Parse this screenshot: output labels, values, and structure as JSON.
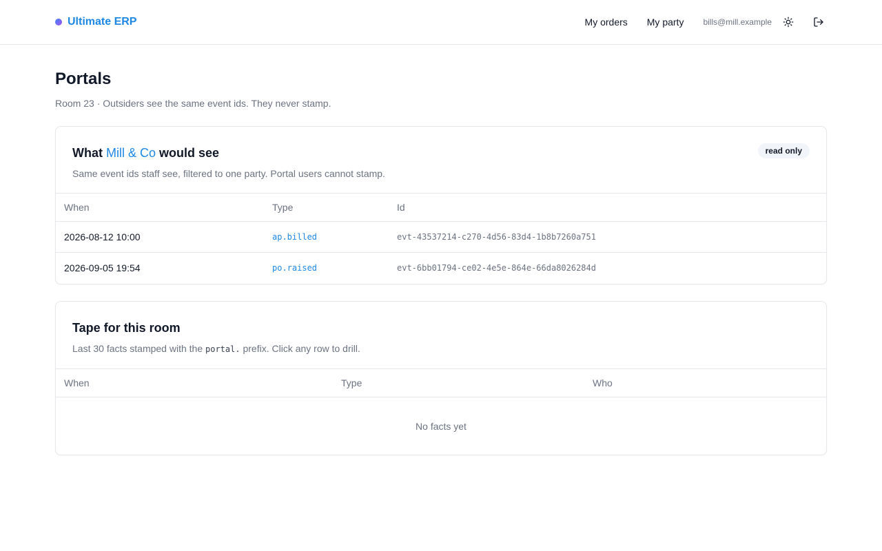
{
  "app": {
    "name": "Ultimate ERP",
    "nav": [
      "My orders",
      "My party"
    ],
    "user_email": "bills@mill.example",
    "icons": {
      "theme": "sun-icon",
      "logout": "logout-icon"
    }
  },
  "page": {
    "title": "Portals",
    "subtitle": "Room 23 · Outsiders see the same event ids. They never stamp."
  },
  "portal_card": {
    "title_prefix": "What ",
    "party": "Mill & Co",
    "title_suffix": " would see",
    "badge": "read only",
    "description": "Same event ids staff see, filtered to one party. Portal users cannot stamp.",
    "columns": [
      "When",
      "Type",
      "Id"
    ],
    "rows": [
      {
        "when": "2026-08-12 10:00",
        "type": "ap.billed",
        "id": "evt-43537214-c270-4d56-83d4-1b8b7260a751"
      },
      {
        "when": "2026-09-05 19:54",
        "type": "po.raised",
        "id": "evt-6bb01794-ce02-4e5e-864e-66da8026284d"
      }
    ]
  },
  "tape_card": {
    "title": "Tape for this room",
    "desc_before": "Last 30 facts stamped with the ",
    "desc_code": "portal.",
    "desc_after": " prefix. Click any row to drill.",
    "columns": [
      "When",
      "Type",
      "Who"
    ],
    "empty_text": "No facts yet"
  },
  "colors": {
    "accent": "#1d87e6",
    "muted_text": "#6b7280",
    "border": "#e5e7eb",
    "badge_bg": "#f1f5f9"
  }
}
